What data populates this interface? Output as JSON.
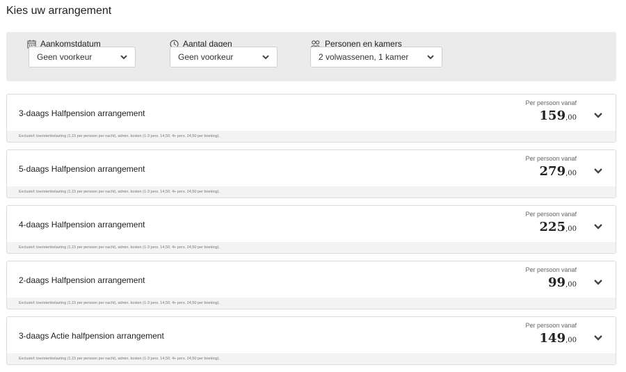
{
  "page": {
    "title": "Kies uw arrangement"
  },
  "filters": {
    "arrival": {
      "label": "Aankomstdatum",
      "icon": "calendar-icon",
      "value": "Geen voorkeur"
    },
    "days": {
      "label": "Aantal dagen",
      "icon": "clock-icon",
      "value": "Geen voorkeur"
    },
    "persons": {
      "label": "Personen en kamers",
      "icon": "persons-icon",
      "value": "2 volwassenen, 1 kamer"
    }
  },
  "arrangements": [
    {
      "title": "3-daags Halfpension arrangement",
      "per_person": "Per persoon vanaf",
      "price_int": "159",
      "price_dec": ",00",
      "note": "Exclusief: toeristenbelasting (1,15 per persoon per nacht), admin. kosten (1-3 pers. 14,50, 4+ pers. 24,50 per boeking)."
    },
    {
      "title": "5-daags Halfpension arrangement",
      "per_person": "Per persoon vanaf",
      "price_int": "279",
      "price_dec": ",00",
      "note": "Exclusief: toeristenbelasting (1,15 per persoon per nacht), admin. kosten (1-3 pers. 14,50, 4+ pers. 24,50 per boeking)."
    },
    {
      "title": "4-daags Halfpension arrangement",
      "per_person": "Per persoon vanaf",
      "price_int": "225",
      "price_dec": ",00",
      "note": "Exclusief: toeristenbelasting (1,15 per persoon per nacht), admin. kosten (1-3 pers. 14,50, 4+ pers. 24,50 per boeking)."
    },
    {
      "title": "2-daags Halfpension arrangement",
      "per_person": "Per persoon vanaf",
      "price_int": "99",
      "price_dec": ",00",
      "note": "Exclusief: toeristenbelasting (1,15 per persoon per nacht), admin. kosten (1-3 pers. 14,50, 4+ pers. 24,50 per boeking)."
    },
    {
      "title": "3-daags Actie halfpension arrangement",
      "per_person": "Per persoon vanaf",
      "price_int": "149",
      "price_dec": ",00",
      "note": "Exclusief: toeristenbelasting (1,15 per persoon per nacht), admin. kosten (1-3 pers. 14,50, 4+ pers. 24,50 per boeking)."
    }
  ]
}
